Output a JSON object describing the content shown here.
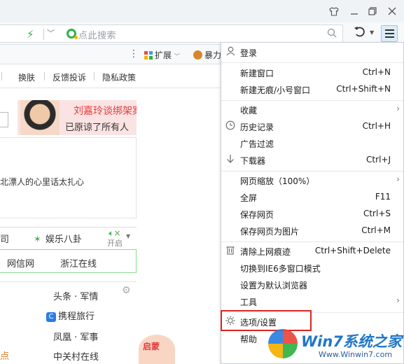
{
  "address_bar": {
    "search_placeholder": "点此搜索"
  },
  "extension_bar": {
    "extensions_label": "扩展",
    "partial_item": "暴力"
  },
  "page_nav": [
    "换肤",
    "反馈投诉",
    "隐私政策"
  ],
  "ad_banner": {
    "title": "刘嘉玲谈绑架案",
    "subtitle": "已原谅了所有人"
  },
  "news": {
    "line": "北漂人的心里话太扎心"
  },
  "tabs": {
    "left_partial": "司",
    "entertainment": "娱乐八卦",
    "toggle_label": "开启"
  },
  "green_links": [
    "网信网",
    "浙江在线"
  ],
  "links": [
    {
      "label": "头条 · 军情"
    },
    {
      "label": "携程旅行"
    },
    {
      "label": "凤凰 · 军事"
    },
    {
      "label": "中关村在线"
    }
  ],
  "orange_partial": "点",
  "promo": "启蒙",
  "menu": {
    "login": "登录",
    "groups": [
      [
        {
          "label": "新建窗口",
          "shortcut": "Ctrl+N"
        },
        {
          "label": "新建无痕/小号窗口",
          "shortcut": "Ctrl+Shift+N"
        }
      ],
      [
        {
          "label": "收藏",
          "submenu": true
        },
        {
          "label": "历史记录",
          "shortcut": "Ctrl+H",
          "icon": "clock-icon"
        },
        {
          "label": "广告过滤"
        },
        {
          "label": "下载器",
          "shortcut": "Ctrl+J",
          "icon": "download-arrow-icon"
        }
      ],
      [
        {
          "label": "网页缩放（100%）",
          "submenu": true
        },
        {
          "label": "全屏",
          "shortcut": "F11"
        },
        {
          "label": "保存网页",
          "shortcut": "Ctrl+S"
        },
        {
          "label": "保存网页为图片",
          "shortcut": "Ctrl+M"
        }
      ],
      [
        {
          "label": "清除上网痕迹",
          "shortcut": "Ctrl+Shift+Delete",
          "icon": "trash-icon"
        },
        {
          "label": "切换到IE6多窗口模式"
        },
        {
          "label": "设置为默认浏览器"
        },
        {
          "label": "工具",
          "submenu": true
        }
      ],
      [
        {
          "label": "选项/设置",
          "icon": "gear-icon",
          "highlighted": true
        },
        {
          "label": "帮助"
        }
      ]
    ],
    "labels_flat": {
      "new_window": "新建窗口",
      "new_window_sc": "Ctrl+N",
      "incognito": "新建无痕/小号窗口",
      "incognito_sc": "Ctrl+Shift+N",
      "favorites": "收藏",
      "history": "历史记录",
      "history_sc": "Ctrl+H",
      "adblock": "广告过滤",
      "downloads": "下载器",
      "downloads_sc": "Ctrl+J",
      "zoom": "网页缩放（100%）",
      "fullscreen": "全屏",
      "fullscreen_sc": "F11",
      "save_page": "保存网页",
      "save_page_sc": "Ctrl+S",
      "save_image": "保存网页为图片",
      "save_image_sc": "Ctrl+M",
      "clear_traces": "清除上网痕迹",
      "clear_traces_sc": "Ctrl+Shift+Delete",
      "ie6_mode": "切换到IE6多窗口模式",
      "set_default": "设置为默认浏览器",
      "tools": "工具",
      "options": "选项/设置",
      "help": "帮助"
    }
  },
  "watermark": {
    "title": "Win7系统之家",
    "url": "Www.Winwin7.com"
  },
  "colors": {
    "highlight_border": "#d9251d",
    "brand_green": "#2fb142",
    "ad_red": "#e43c3c",
    "watermark_blue": "#1f77c9"
  }
}
